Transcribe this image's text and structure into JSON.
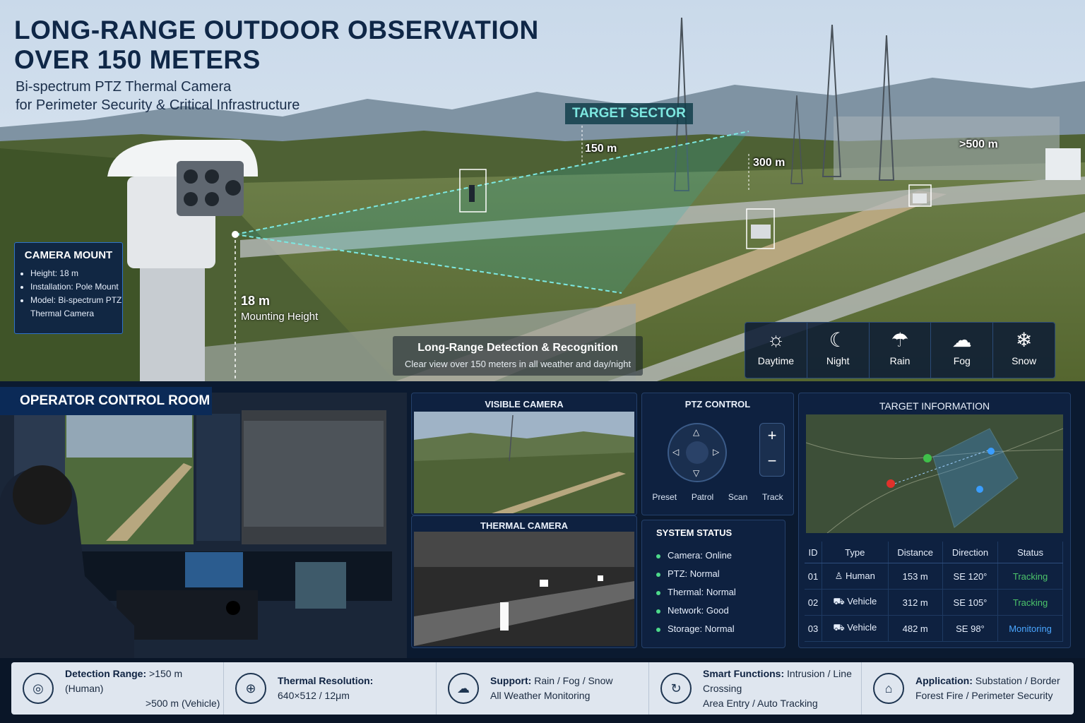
{
  "header": {
    "title_line1": "LONG-RANGE OUTDOOR OBSERVATION",
    "title_line2": "OVER 150 METERS",
    "subtitle_line1": "Bi-spectrum PTZ Thermal Camera",
    "subtitle_line2": "for Perimeter Security & Critical Infrastructure"
  },
  "scene": {
    "target_sector": "TARGET SECTOR",
    "dist_150": "150 m",
    "dist_300": "300 m",
    "dist_500": ">500 m",
    "height_value": "18 m",
    "height_label": "Mounting Height",
    "detection_title": "Long-Range Detection & Recognition",
    "detection_sub": "Clear view over 150 meters in all weather and day/night"
  },
  "camera_mount": {
    "title": "CAMERA MOUNT",
    "items": [
      "Height: 18 m",
      "Installation: Pole Mount",
      "Model: Bi-spectrum PTZ Thermal Camera"
    ]
  },
  "weather": [
    {
      "label": "Daytime",
      "icon": "☼"
    },
    {
      "label": "Night",
      "icon": "☾"
    },
    {
      "label": "Rain",
      "icon": "☂"
    },
    {
      "label": "Fog",
      "icon": "☁"
    },
    {
      "label": "Snow",
      "icon": "❄"
    }
  ],
  "control_room": {
    "title": "OPERATOR CONTROL ROOM"
  },
  "visible_camera": {
    "title": "VISIBLE CAMERA"
  },
  "thermal_camera": {
    "title": "THERMAL CAMERA"
  },
  "ptz": {
    "title": "PTZ CONTROL",
    "zoom_in": "+",
    "zoom_out": "−",
    "buttons": [
      "Preset",
      "Patrol",
      "Scan",
      "Track"
    ]
  },
  "system_status": {
    "title": "SYSTEM STATUS",
    "items": [
      "Camera: Online",
      "PTZ: Normal",
      "Thermal: Normal",
      "Network: Good",
      "Storage: Normal"
    ]
  },
  "target_info": {
    "title": "TARGET INFORMATION",
    "columns": [
      "ID",
      "Type",
      "Distance",
      "Direction",
      "Status"
    ],
    "rows": [
      {
        "id": "01",
        "type": "Human",
        "distance": "153 m",
        "direction": "SE 120°",
        "status": "Tracking",
        "status_color": "#4cc46a"
      },
      {
        "id": "02",
        "type": "Vehicle",
        "distance": "312 m",
        "direction": "SE 105°",
        "status": "Tracking",
        "status_color": "#4cc46a"
      },
      {
        "id": "03",
        "type": "Vehicle",
        "distance": "482 m",
        "direction": "SE 98°",
        "status": "Monitoring",
        "status_color": "#4aa6ff"
      }
    ]
  },
  "footer": [
    {
      "label": "Detection Range:",
      "line1": " >150 m (Human)",
      "line2": ">500 m (Vehicle)",
      "icon": "◎"
    },
    {
      "label": "Thermal Resolution:",
      "line1": "",
      "line2": "640×512 / 12μm",
      "icon": "⊕"
    },
    {
      "label": "Support:",
      "line1": " Rain / Fog / Snow",
      "line2": "All Weather Monitoring",
      "icon": "☁"
    },
    {
      "label": "Smart Functions:",
      "line1": " Intrusion / Line Crossing",
      "line2": "Area Entry / Auto Tracking",
      "icon": "↻"
    },
    {
      "label": "Application:",
      "line1": " Substation / Border",
      "line2": "Forest Fire / Perimeter Security",
      "icon": "⌂"
    }
  ],
  "colors": {
    "accent": "#2f72c9",
    "status_ok": "#4dd98a",
    "tracking": "#4cc46a",
    "monitoring": "#4aa6ff",
    "sector": "#7de7e0"
  }
}
